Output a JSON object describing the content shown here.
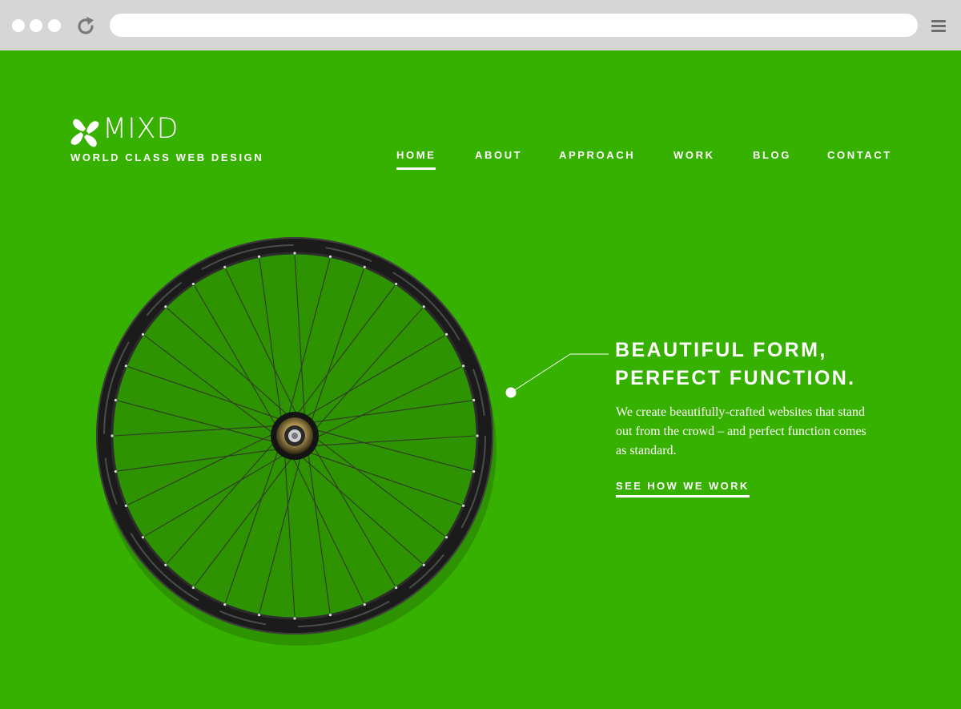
{
  "browser": {
    "window_controls": [
      "window-dot-1",
      "window-dot-2",
      "window-dot-3"
    ],
    "reload_icon": "reload-icon",
    "address": "",
    "menu_icon": "hamburger-menu-icon"
  },
  "brand": {
    "logo_icon": "pinwheel-logo-icon",
    "name": "MIXD",
    "tagline": "WORLD CLASS WEB DESIGN"
  },
  "nav": {
    "items": [
      {
        "label": "HOME",
        "active": true
      },
      {
        "label": "ABOUT",
        "active": false
      },
      {
        "label": "APPROACH",
        "active": false
      },
      {
        "label": "WORK",
        "active": false
      },
      {
        "label": "BLOG",
        "active": false
      },
      {
        "label": "CONTACT",
        "active": false
      }
    ]
  },
  "hero": {
    "image": "bicycle-wheel",
    "title_line1": "BEAUTIFUL FORM,",
    "title_line2": "PERFECT FUNCTION.",
    "body": "We create beautifully-crafted websites that stand out from the crowd – and perfect function comes as standard.",
    "cta": "SEE HOW WE WORK"
  },
  "colors": {
    "background": "#37b100",
    "chrome": "#d6d6d6",
    "text": "#ffffff"
  }
}
